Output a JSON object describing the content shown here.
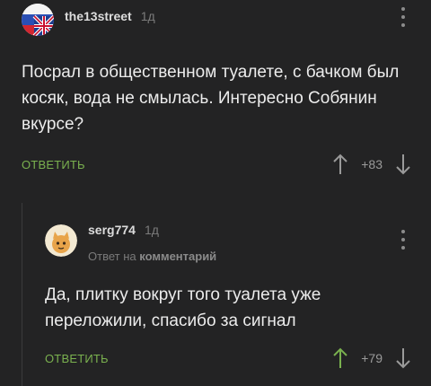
{
  "comments": [
    {
      "username": "the13street",
      "time": "1д",
      "text": "Посрал в общественном туалете, с бачком был косяк, вода не смылась. Интересно Собянин вкурсе?",
      "reply_label": "ОТВЕТИТЬ",
      "score": "+83",
      "upvote_active": false
    },
    {
      "username": "serg774",
      "time": "1д",
      "reply_to_prefix": "Ответ на",
      "reply_to_target": "комментарий",
      "text": "Да, плитку вокруг того туалета уже переложили, спасибо за сигнал",
      "reply_label": "ОТВЕТИТЬ",
      "score": "+79",
      "upvote_active": true
    }
  ],
  "colors": {
    "background": "#232324",
    "accent_green": "#7ab14f",
    "muted_text": "#7a7a7a"
  },
  "icons": {
    "avatar_1": "flags-avatar",
    "avatar_2": "cat-avatar",
    "menu": "vertical-dots-icon",
    "upvote": "arrow-up-icon",
    "downvote": "arrow-down-icon"
  }
}
